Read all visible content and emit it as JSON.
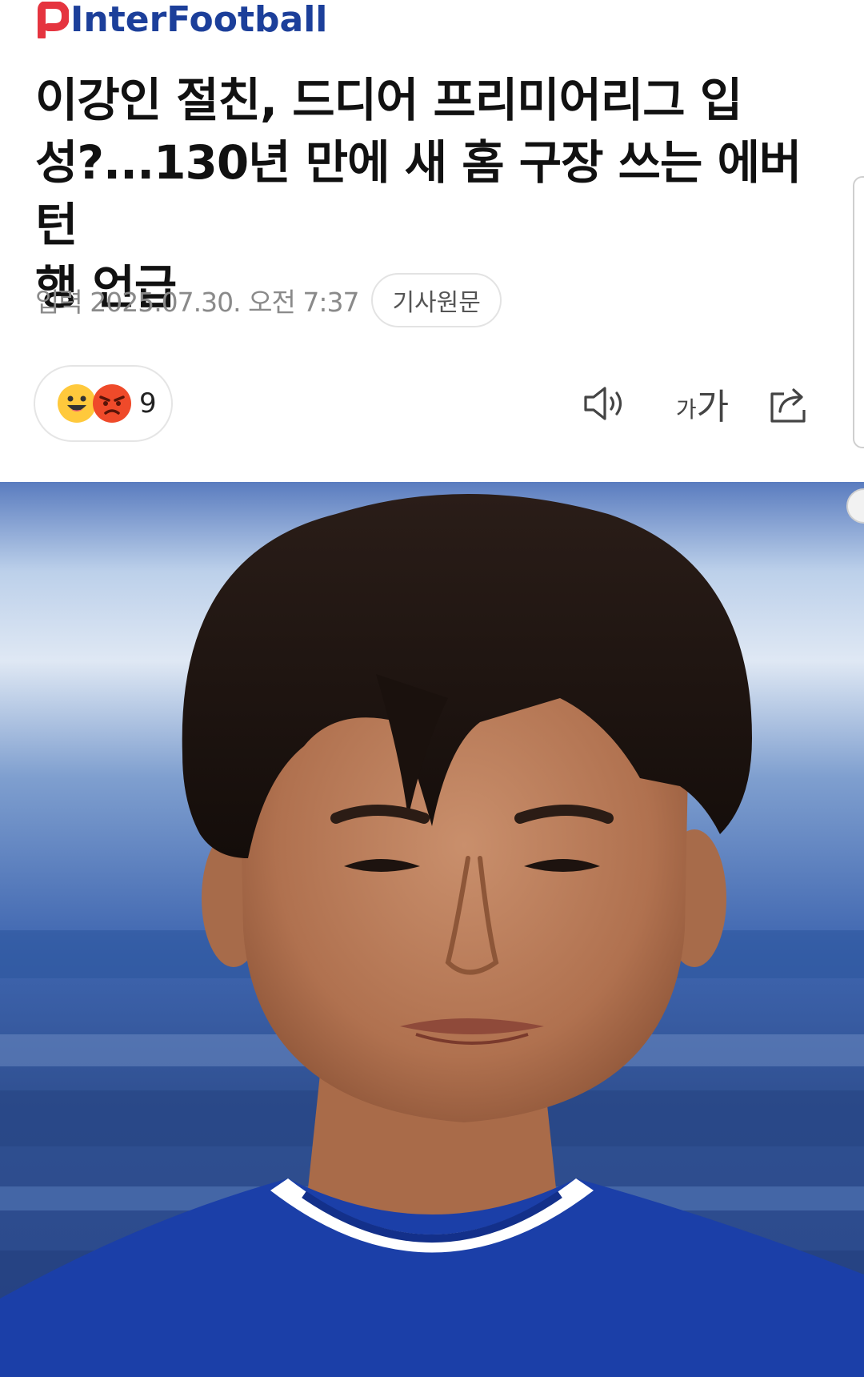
{
  "header": {
    "logo_text": "InterFootball",
    "logo_color": "#1c3f9a",
    "logo_mark_color": "#e5343f"
  },
  "article": {
    "headline_lines": [
      "이강인 절친, 드디어 프리미어리그 입",
      "성?...130년 만에 새 홈 구장 쓰는 에버턴",
      "행 언급"
    ],
    "date": "입력 2025.07.30. 오전 7:37",
    "origin_button_label": "기사원문"
  },
  "reactions": {
    "count": "9",
    "emojis": [
      "smiling-face",
      "angry-face"
    ]
  },
  "toolbar": {
    "font_small": "가",
    "font_big": "가",
    "icons": [
      "speaker-icon",
      "font-size-icon",
      "share-icon"
    ]
  },
  "photo": {
    "subject": "football-player-portrait",
    "kit_color": "#1b3fa8"
  }
}
